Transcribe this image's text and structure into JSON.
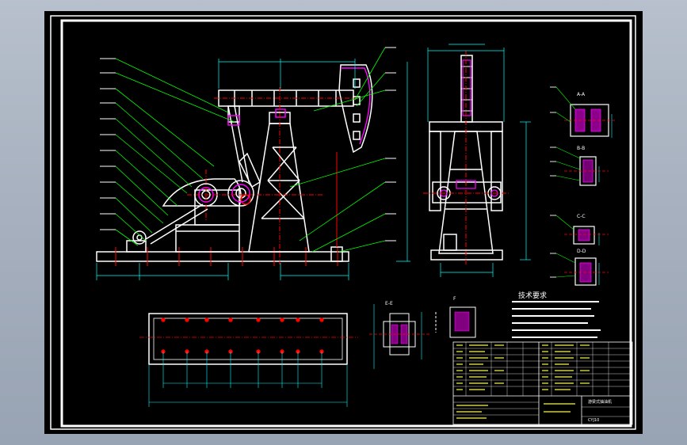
{
  "colors": {
    "background": "#000000",
    "frame": "#ffffff",
    "structure": "#ffffff",
    "leader": "#00ff00",
    "dimension": "#00ffff",
    "centerline": "#ff0000",
    "magenta": "#ff00ff",
    "table_text": "#ffff00"
  },
  "technical_notes": {
    "title": "技术要求"
  },
  "sections": {
    "view_a": "A-A",
    "view_b": "B-B",
    "view_c": "C-C",
    "view_d": "D-D",
    "view_e": "E-E",
    "view_f": "F"
  },
  "title_block": {
    "drawing_name": "游梁式抽油机",
    "drawing_no": "CYJ10"
  },
  "icons": {
    "drawing_canvas": "cad-drawing-icon"
  }
}
